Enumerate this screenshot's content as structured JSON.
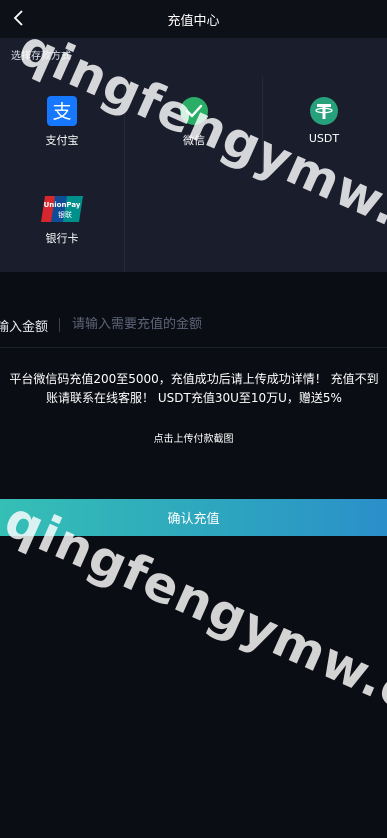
{
  "header": {
    "title": "充值中心",
    "back_icon": "chevron-left-icon"
  },
  "payment": {
    "section_label": "选择存款方式",
    "methods": [
      {
        "label": "支付宝",
        "icon": "alipay-icon",
        "color": "#1677ff"
      },
      {
        "label": "微信",
        "icon": "wechat-icon",
        "color": "#2aae67"
      },
      {
        "label": "USDT",
        "icon": "tether-icon",
        "color": "#26a17b"
      },
      {
        "label": "银行卡",
        "icon": "unionpay-icon",
        "color": "#d7262e"
      }
    ]
  },
  "amount": {
    "label": "输入金额",
    "placeholder": "请输入需要充值的金额",
    "value": ""
  },
  "notice": {
    "line1": "平台微信码充值200至5000，充值成功后请上传成功详情！ 充值不到",
    "line2": "账请联系在线客服！ USDT充值30U至10万U，赠送5%"
  },
  "upload": {
    "label": "点击上传付款截图"
  },
  "confirm": {
    "label": "确认充值"
  },
  "watermark": {
    "text": "qingfengymw.com"
  },
  "colors": {
    "background": "#0b0d14",
    "panel": "#1a1e2c",
    "button_start": "#35bfb5",
    "button_end": "#2b8fca"
  }
}
